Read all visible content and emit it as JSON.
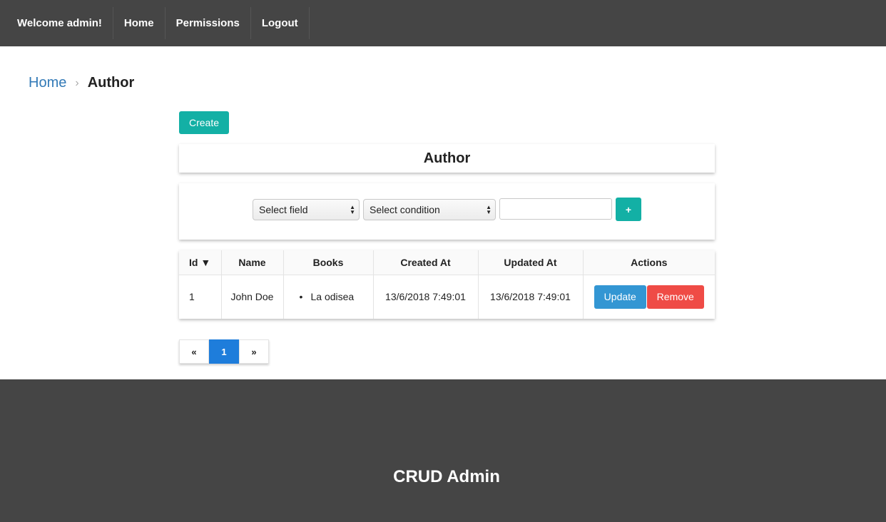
{
  "nav": {
    "welcome": "Welcome admin!",
    "home": "Home",
    "permissions": "Permissions",
    "logout": "Logout"
  },
  "breadcrumb": {
    "home": "Home",
    "separator": "›",
    "current": "Author"
  },
  "create_label": "Create",
  "panel_title": "Author",
  "filter": {
    "field_select": "Select field",
    "condition_select": "Select condition",
    "value": "",
    "add_label": "+"
  },
  "table": {
    "headers": {
      "id": "Id ▼",
      "name": "Name",
      "books": "Books",
      "created_at": "Created At",
      "updated_at": "Updated At",
      "actions": "Actions"
    },
    "rows": [
      {
        "id": "1",
        "name": "John Doe",
        "books": [
          "La odisea"
        ],
        "created_at": "13/6/2018 7:49:01",
        "updated_at": "13/6/2018 7:49:01",
        "update_label": "Update",
        "remove_label": "Remove"
      }
    ]
  },
  "pagination": {
    "prev": "«",
    "current": "1",
    "next": "»"
  },
  "footer": {
    "title": "CRUD Admin"
  },
  "colors": {
    "nav_bg": "#454545",
    "accent_teal": "#13b0a5",
    "update_blue": "#3396d3",
    "remove_red": "#ef4b46",
    "page_active": "#1e7ddb",
    "link_blue": "#337ab7"
  }
}
